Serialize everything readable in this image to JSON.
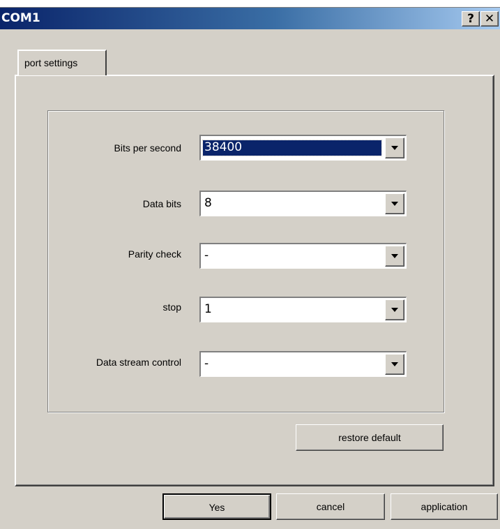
{
  "window": {
    "title": "COM1",
    "help_label": "?",
    "close_label": "✕"
  },
  "tabs": [
    {
      "label": "port settings",
      "active": true
    }
  ],
  "settings": [
    {
      "label": "Bits per second",
      "value": "38400",
      "focused": true
    },
    {
      "label": "Data bits",
      "value": "8"
    },
    {
      "label": "Parity check",
      "value": "-"
    },
    {
      "label": "stop",
      "value": "1"
    },
    {
      "label": "Data stream control",
      "value": "-"
    }
  ],
  "buttons": {
    "restore_default": "restore default",
    "yes": "Yes",
    "cancel": "cancel",
    "application": "application"
  },
  "colors": {
    "titlebar_start": "#0a246a",
    "titlebar_end": "#a6caf0",
    "face": "#d4d0c8",
    "selection": "#0a246a"
  }
}
